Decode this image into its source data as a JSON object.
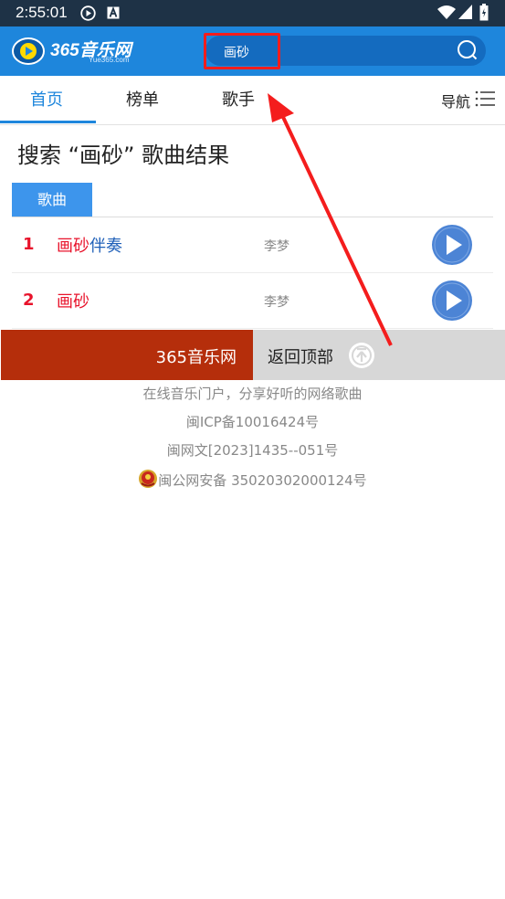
{
  "status_bar": {
    "time": "2:55:01",
    "icons": [
      "play-circle-icon",
      "a-icon",
      "wifi-icon",
      "signal-icon",
      "battery-icon"
    ]
  },
  "header": {
    "logo_text": "365音乐网",
    "logo_subtext": "Yue365.com",
    "search_value": "画砂",
    "search_icon": "search-icon",
    "colors": {
      "background": "#1e86dc",
      "search_bg": "#146bbf",
      "highlight": "#f41d1d"
    }
  },
  "nav": {
    "tabs": [
      {
        "label": "首页",
        "active": true
      },
      {
        "label": "榜单",
        "active": false
      },
      {
        "label": "歌手",
        "active": false
      }
    ],
    "guide_label": "导航",
    "guide_icon": "list-menu-icon",
    "accent": "#1e86dc"
  },
  "search_results": {
    "title": "搜索 “画砂” 歌曲结果",
    "category_tab": "歌曲",
    "songs": [
      {
        "num": "1",
        "title_hl": "画砂",
        "title_rest": "伴奏",
        "artist": "李梦",
        "action_icon": "play-icon"
      },
      {
        "num": "2",
        "title_hl": "画砂",
        "title_rest": "",
        "artist": "李梦",
        "action_icon": "play-icon"
      }
    ]
  },
  "footer": {
    "site_name": "365音乐网",
    "back_to_top": "返回顶部",
    "back_to_top_icon": "arrow-up-circle-icon",
    "tagline": "在线音乐门户，分享好听的网络歌曲",
    "icp": "闽ICP备10016424号",
    "license": "闽网文[2023]1435--051号",
    "police_icon": "police-emblem-icon",
    "police_record": "闽公网安备 35020302000124号",
    "colors": {
      "left": "#b52e0b",
      "right": "#d7d7d7"
    }
  }
}
